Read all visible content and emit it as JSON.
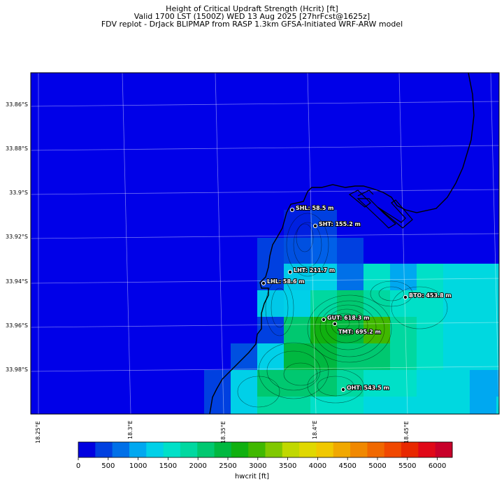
{
  "title": {
    "line1": "Height of Critical Updraft Strength (Hcrit) [ft]",
    "line2": "Valid 1700 LST (1500Z) WED 13 Aug 2025 [27hrFcst@1625z]",
    "line3": "FDV replot - DrJack BLIPMAP from RASP 1.3km GFSA-Initiated WRF-ARW model"
  },
  "map": {
    "lat_labels": [
      "33.86°S",
      "33.88°S",
      "33.9°S",
      "33.92°S",
      "33.94°S",
      "33.96°S",
      "33.98°S"
    ],
    "lon_labels": [
      "18.25°E",
      "18.3°E",
      "18.35°E",
      "18.4°E",
      "18.45°E"
    ],
    "sites": [
      {
        "label": "SHL: 58.5 m"
      },
      {
        "label": "SHT: 155.2 m"
      },
      {
        "label": "LHT: 211.7 m"
      },
      {
        "label": "LHL: 58.6 m"
      },
      {
        "label": "BTO: 453.8 m"
      },
      {
        "label": "GUT: 618.3 m"
      },
      {
        "label": "TMT: 695.2 m"
      },
      {
        "label": "OHT: 543.5 m"
      }
    ]
  },
  "colorbar": {
    "label": "hwcrit [ft]",
    "ticks": [
      "0",
      "500",
      "1000",
      "1500",
      "2000",
      "2500",
      "3000",
      "3500",
      "4000",
      "4500",
      "5000",
      "5500",
      "6000"
    ],
    "colors": [
      "#0000e0",
      "#0040e0",
      "#0070e8",
      "#00a8f0",
      "#00d0e8",
      "#00e0c8",
      "#00d8a0",
      "#00c870",
      "#00b840",
      "#10b010",
      "#40b800",
      "#80c800",
      "#c0d800",
      "#e0d800",
      "#f0c800",
      "#f0a800",
      "#f08800",
      "#f06800",
      "#f04800",
      "#e82800",
      "#e00818",
      "#c8002a"
    ],
    "accent_ocean": "#0000e8"
  }
}
